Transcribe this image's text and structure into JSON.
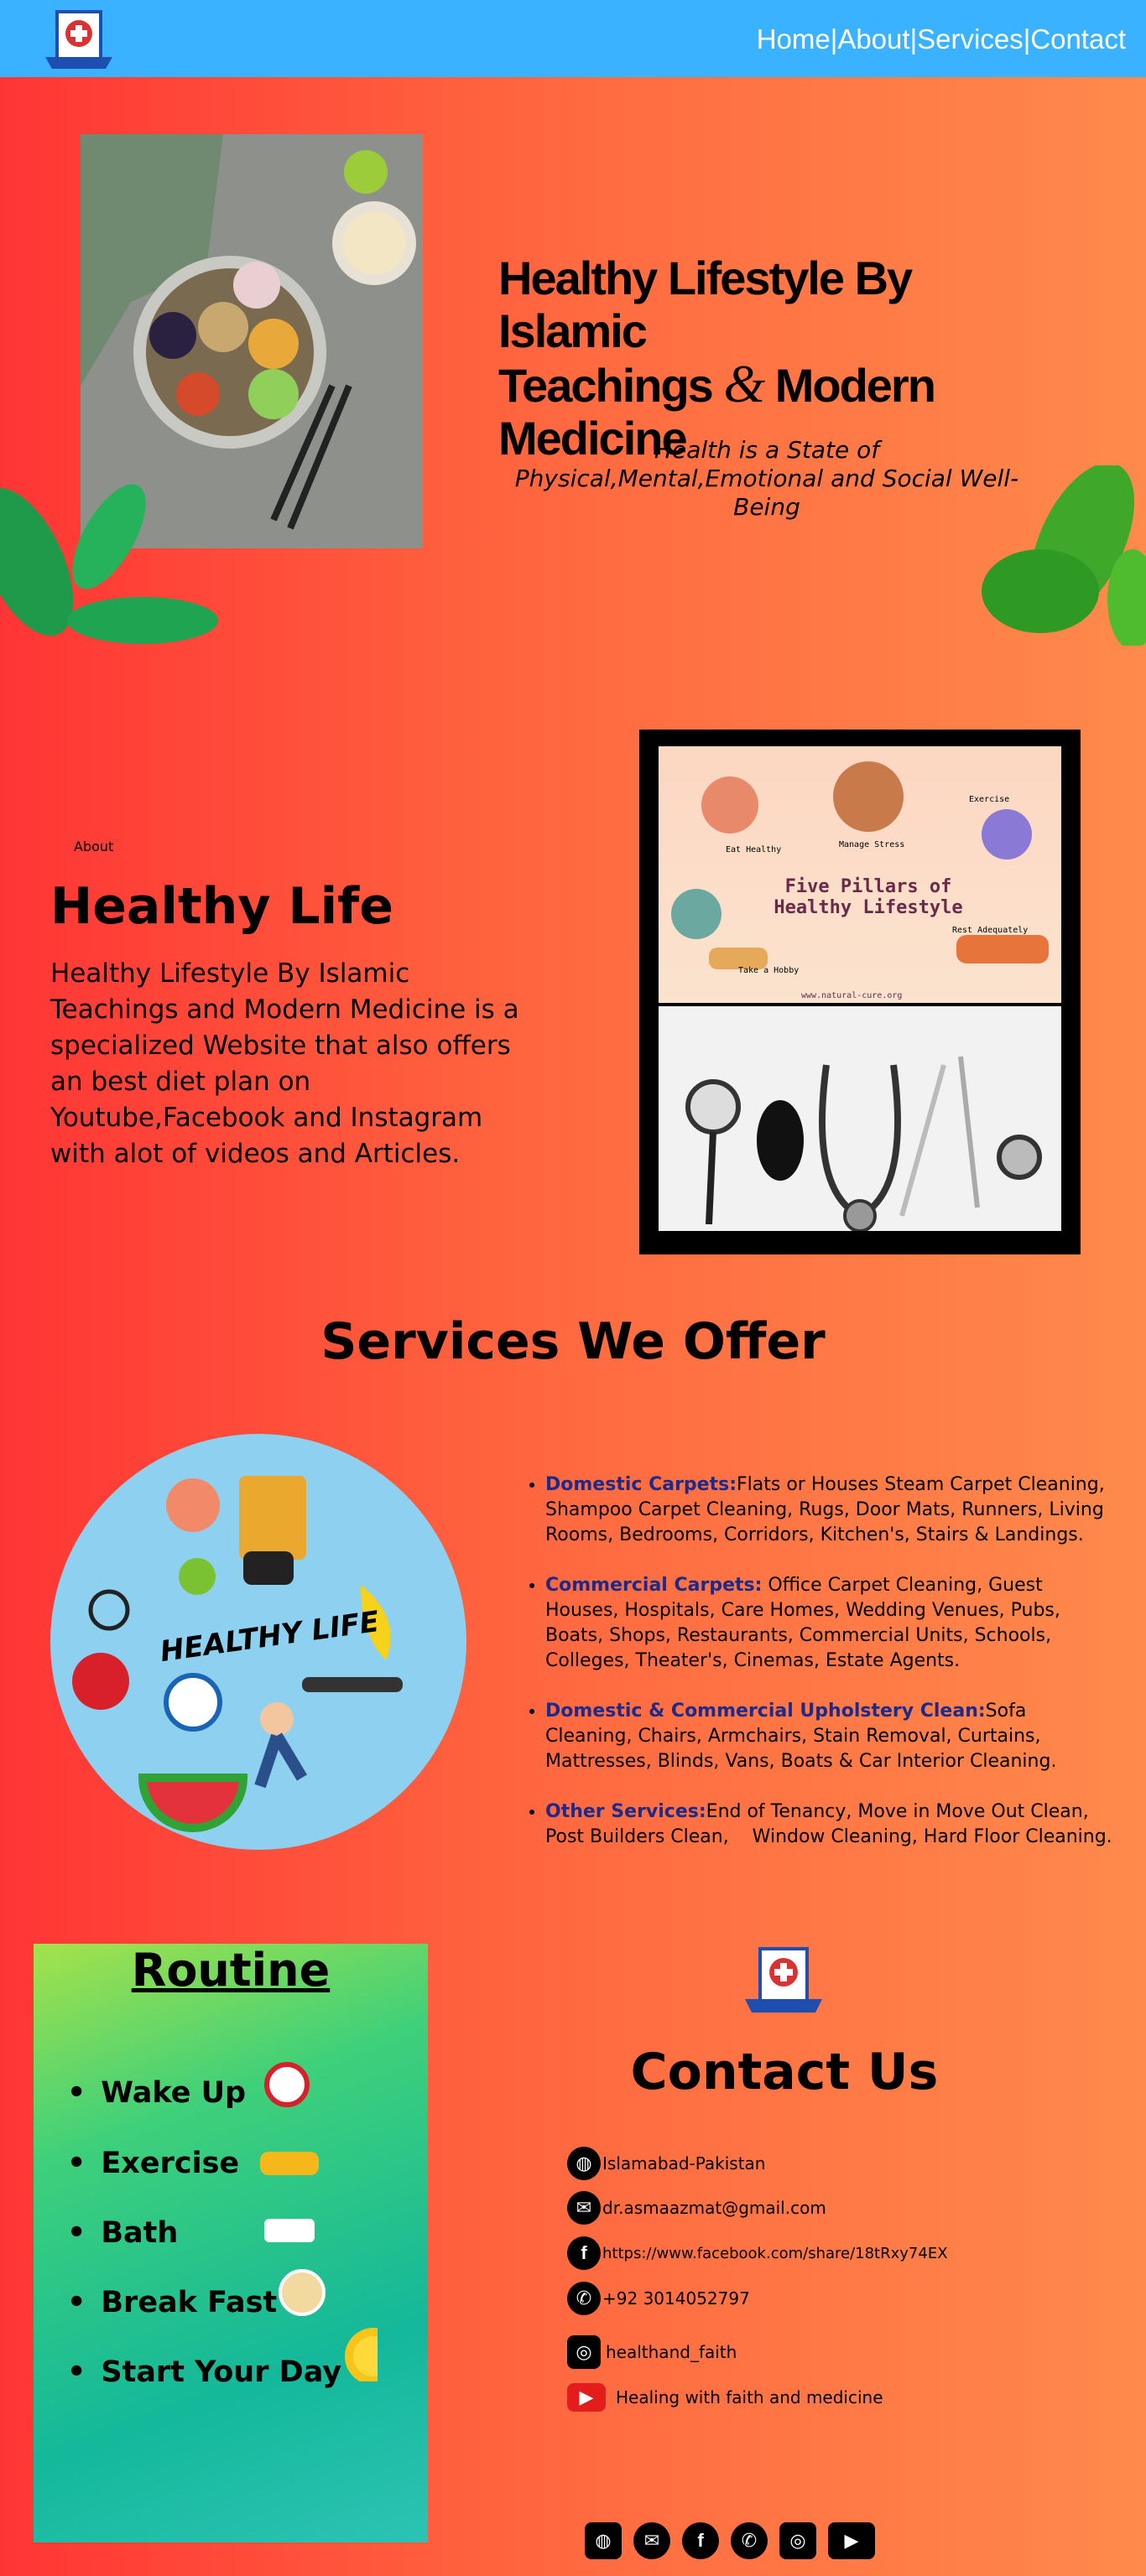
{
  "header": {
    "nav": [
      "Home",
      "|",
      "About",
      "|",
      "Services",
      "|",
      "Contact"
    ],
    "logo_text": "Health Care"
  },
  "hero": {
    "title_line1": "Healthy Lifestyle By Islamic",
    "title_line2a": "Teachings ",
    "title_amp": "&",
    "title_line2b": " Modern",
    "title_line3": "Medicine",
    "subtitle": "Health is a State of Physical,Mental,Emotional and Social Well-Being"
  },
  "about": {
    "tag": "About",
    "title": "Healthy Life",
    "text": "Healthy Lifestyle By Islamic Teachings and Modern Medicine is a specialized Website that also offers an best diet plan on Youtube,Facebook and Instagram with alot of videos and Articles.",
    "poster": {
      "title": "Five Pillars of Healthy Lifestyle",
      "labels": [
        "Eat Healthy",
        "Manage Stress",
        "Exercise",
        "Take a Hobby",
        "Rest Adequately"
      ],
      "url": "www.natural-cure.org"
    }
  },
  "services": {
    "title": "Services We Offer",
    "circle_text": "HEALTHY LIFE",
    "items": [
      {
        "name": "Domestic Carpets:",
        "desc": "Flats or Houses Steam Carpet Cleaning, Shampoo Carpet Cleaning, Rugs, Door Mats, Runners, Living Rooms, Bedrooms, Corridors, Kitchen's, Stairs & Landings."
      },
      {
        "name": "Commercial Carpets:",
        "desc": " Office Carpet Cleaning, Guest Houses, Hospitals, Care Homes, Wedding Venues, Pubs, Boats, Shops, Restaurants, Commercial Units, Schools, Colleges, Theater's, Cinemas, Estate Agents."
      },
      {
        "name": "Domestic & Commercial Upholstery Clean:",
        "desc": "Sofa Cleaning, Chairs, Armchairs, Stain Removal, Curtains, Mattresses, Blinds, Vans, Boats & Car Interior Cleaning."
      },
      {
        "name": "Other Services:",
        "desc": "End of Tenancy, Move in Move Out Clean, Post Builders Clean,    Window Cleaning, Hard Floor Cleaning."
      }
    ]
  },
  "routine": {
    "title": "Routine",
    "items": [
      "Wake Up",
      "Exercise",
      "Bath",
      "Break Fast",
      "Start Your Day"
    ]
  },
  "contact": {
    "title": "Contact Us",
    "location": "Islamabad-Pakistan",
    "email": "dr.asmaazmat@gmail.com",
    "facebook": "https://www.facebook.com/share/18tRxy74EX",
    "phone": "+92 3014052797",
    "instagram": "healthand_faith",
    "youtube": "Healing with faith and medicine"
  },
  "colors": {
    "header": "#3bb2ff",
    "service_name": "#1d2a8a"
  }
}
